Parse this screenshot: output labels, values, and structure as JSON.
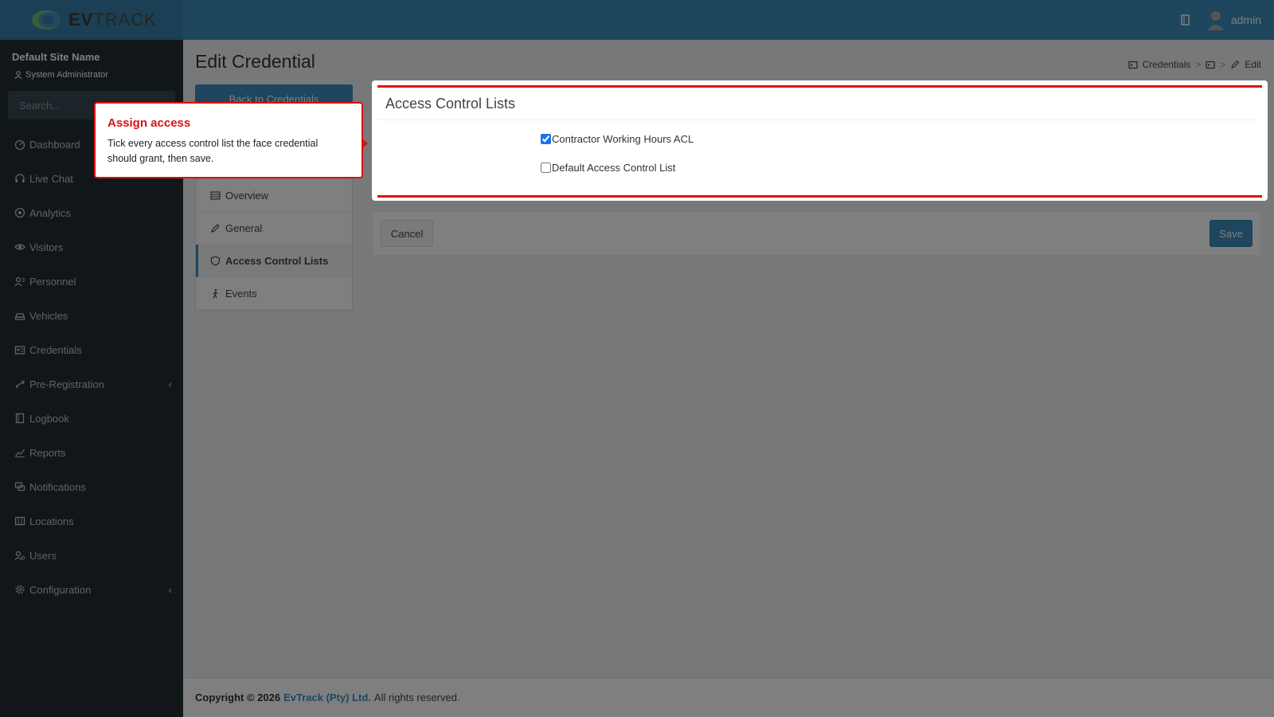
{
  "brand": {
    "logo_text_bold": "EV",
    "logo_text_rest": "TRACK"
  },
  "topbar": {
    "user": "admin"
  },
  "sidebar": {
    "site_name": "Default Site Name",
    "role": "System Administrator",
    "search_placeholder": "Search...",
    "items": [
      {
        "label": "Dashboard"
      },
      {
        "label": "Live Chat"
      },
      {
        "label": "Analytics"
      },
      {
        "label": "Visitors"
      },
      {
        "label": "Personnel"
      },
      {
        "label": "Vehicles"
      },
      {
        "label": "Credentials"
      },
      {
        "label": "Pre-Registration"
      },
      {
        "label": "Logbook"
      },
      {
        "label": "Reports"
      },
      {
        "label": "Notifications"
      },
      {
        "label": "Locations"
      },
      {
        "label": "Users"
      },
      {
        "label": "Configuration"
      }
    ]
  },
  "page": {
    "title": "Edit Credential",
    "breadcrumb": {
      "credentials": "Credentials",
      "edit": "Edit"
    },
    "back_label": "Back to Credentials",
    "tabs": [
      {
        "label": "Overview"
      },
      {
        "label": "General"
      },
      {
        "label": "Access Control Lists"
      },
      {
        "label": "Events"
      }
    ],
    "acl": {
      "title": "Access Control Lists",
      "options": [
        {
          "label": "Contractor Working Hours ACL",
          "checked": true
        },
        {
          "label": "Default Access Control List",
          "checked": false
        }
      ]
    },
    "cancel_label": "Cancel",
    "save_label": "Save"
  },
  "footer": {
    "copyright": "Copyright © 2026",
    "company": "EvTrack (Pty) Ltd.",
    "rights": "All rights reserved."
  },
  "tooltip": {
    "title": "Assign access",
    "body": "Tick every access control list the face credential should grant, then save."
  },
  "colors": {
    "accent": "#3c8dbc",
    "sidebar": "#222d32",
    "highlight": "#dd1111"
  }
}
